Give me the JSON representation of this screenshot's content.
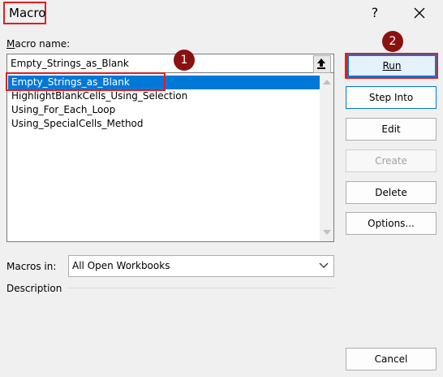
{
  "window": {
    "title": "Macro",
    "help_glyph": "?",
    "close_glyph": "✕"
  },
  "form": {
    "macro_name_label": "Macro name:",
    "macro_name_value": "Empty_Strings_as_Blank",
    "macros_in_label": "Macros in:",
    "macros_in_value": "All Open Workbooks",
    "description_label": "Description"
  },
  "macro_list": [
    "Empty_Strings_as_Blank",
    "HighlightBlankCells_Using_Selection",
    "Using_For_Each_Loop",
    "Using_SpecialCells_Method"
  ],
  "buttons": {
    "run": "Run",
    "step_into": "Step Into",
    "edit": "Edit",
    "create": "Create",
    "delete": "Delete",
    "options": "Options...",
    "cancel": "Cancel"
  },
  "annotations": {
    "step1": "1",
    "step2": "2"
  },
  "colors": {
    "selection": "#0078d7",
    "annotation_box": "#e02020",
    "badge": "#8b1111"
  }
}
